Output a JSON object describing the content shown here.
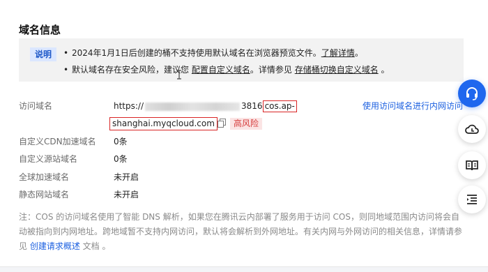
{
  "section": {
    "title": "域名信息"
  },
  "notice": {
    "badge": "说明",
    "line1": {
      "bullet": "•",
      "text": "2024年1月1日后创建的桶不支持使用默认域名在浏览器预览文件。",
      "link": "了解详情",
      "end": "。"
    },
    "line2": {
      "bullet": "•",
      "text": "默认域名存在安全风险，建议您",
      "link1": "配置自定义域名",
      "middle": "。详情参见",
      "link2": "存储桶切换自定义域名",
      "end": "。"
    }
  },
  "rows": {
    "access_domain": {
      "label": "访问域名",
      "url_prefix": "https://",
      "url_suffix_visible": "3816",
      "url_boxed_part1": "cos.ap-",
      "url_boxed_part2": "shanghai.myqcloud.com",
      "risk_badge": "高风险",
      "intranet_link": "使用访问域名进行内网访问"
    },
    "cdn": {
      "label": "自定义CDN加速域名",
      "value": "0条"
    },
    "origin": {
      "label": "自定义源站域名",
      "value": "0条"
    },
    "global": {
      "label": "全球加速域名",
      "value": "未开启"
    },
    "static": {
      "label": "静态网站域名",
      "value": "未开启"
    }
  },
  "footnote": {
    "text": "注：COS 的访问域名使用了智能 DNS 解析，如果您在腾讯云内部署了服务用于访问 COS，则同地域范围内访问将会自动被指向到内网地址。跨地域暂不支持内网访问，默认将会解析到外网地址。有关内网与外网访问的相关信息，详情请参见",
    "link": "创建请求概述",
    "end": " 文档 。"
  },
  "icons": {
    "copy": "copy-icon",
    "support": "headset-icon",
    "cloud": "cloud-icon",
    "docs": "book-icon",
    "toc": "list-icon"
  },
  "colors": {
    "accent": "#1f67ee",
    "link": "#1d61e0",
    "risk": "#d63b3b",
    "highlight_box": "#d92424"
  }
}
